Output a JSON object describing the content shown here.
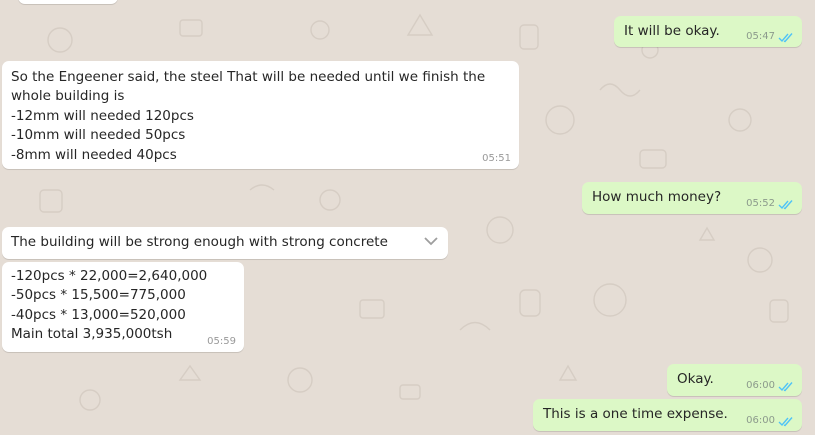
{
  "colors": {
    "background": "#e5ddd5",
    "incoming": "#ffffff",
    "outgoing": "#dcf8c6",
    "read_ticks": "#4fc3f7"
  },
  "messages": [
    {
      "text": "It will be okay.",
      "time": "05:47",
      "direction": "outgoing",
      "status": "read"
    },
    {
      "text": "So the Engeener said, the steel That will be needed until we finish the whole building is\n-12mm will needed 120pcs\n-10mm will needed 50pcs\n-8mm will needed 40pcs",
      "time": "05:51",
      "direction": "incoming"
    },
    {
      "text": "How much money?",
      "time": "05:52",
      "direction": "outgoing",
      "status": "read"
    },
    {
      "text": "The building will be strong enough with strong concrete",
      "direction": "incoming",
      "menu_icon": "chevron-down-icon"
    },
    {
      "text": "-120pcs * 22,000=2,640,000\n-50pcs * 15,500=775,000\n-40pcs * 13,000=520,000\nMain total 3,935,000tsh",
      "time": "05:59",
      "direction": "incoming"
    },
    {
      "text": "Okay.",
      "time": "06:00",
      "direction": "outgoing",
      "status": "read"
    },
    {
      "text": "This is a one time expense.",
      "time": "06:00",
      "direction": "outgoing",
      "status": "read"
    }
  ]
}
